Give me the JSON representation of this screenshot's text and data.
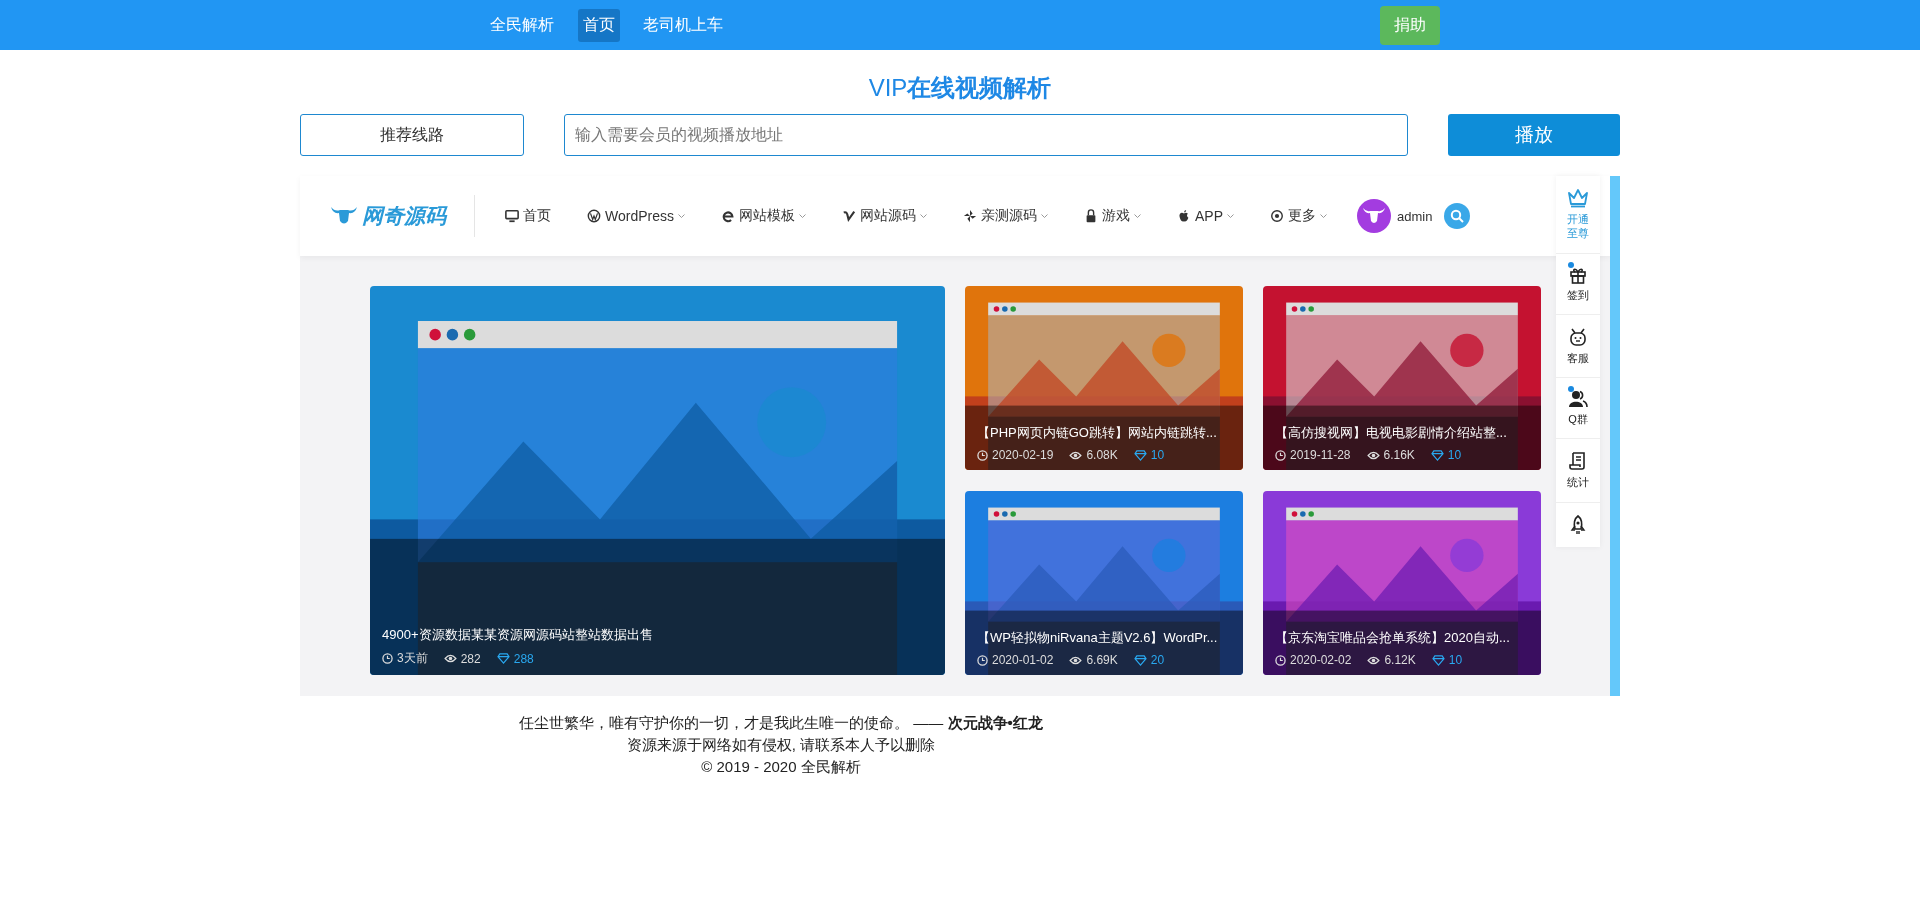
{
  "top_nav": {
    "brand": "全民解析",
    "links": [
      {
        "label": "首页",
        "selected": true
      },
      {
        "label": "老司机上车",
        "selected": false
      }
    ],
    "donate": "捐助"
  },
  "title": "VIP**在线视频解析**",
  "search": {
    "route_button": "推荐线路",
    "placeholder": "输入需要会员的视频播放地址",
    "play_button": "播放"
  },
  "site": {
    "logo": "网奇源码",
    "nav": [
      {
        "label": "首页",
        "dropdown": false
      },
      {
        "label": "WordPress",
        "dropdown": true
      },
      {
        "label": "网站模板",
        "dropdown": true
      },
      {
        "label": "网站源码",
        "dropdown": true
      },
      {
        "label": "亲测源码",
        "dropdown": true
      },
      {
        "label": "游戏",
        "dropdown": true
      },
      {
        "label": "APP",
        "dropdown": true
      },
      {
        "label": "更多",
        "dropdown": true
      }
    ],
    "user": "admin",
    "featured": {
      "title": "4900+资源数据某某资源网源码站整站数据出售",
      "time": "3天前",
      "views": "282",
      "points": "288"
    },
    "cards": [
      {
        "title": "【PHP网页内链GO跳转】网站内链跳转...",
        "time": "2020-02-19",
        "views": "6.08K",
        "points": "10"
      },
      {
        "title": "【高仿搜视网】电视电影剧情介绍站整...",
        "time": "2019-11-28",
        "views": "6.16K",
        "points": "10"
      },
      {
        "title": "【WP轻拟物niRvana主题V2.6】WordPr...",
        "time": "2020-01-02",
        "views": "6.69K",
        "points": "20"
      },
      {
        "title": "【京东淘宝唯品会抢单系统】2020自动...",
        "time": "2020-02-02",
        "views": "6.12K",
        "points": "10"
      }
    ],
    "side_tools": [
      {
        "label": "开通至尊",
        "highlight": true,
        "dot": false
      },
      {
        "label": "签到",
        "highlight": false,
        "dot": true
      },
      {
        "label": "客服",
        "highlight": false,
        "dot": false
      },
      {
        "label": "Q群",
        "highlight": false,
        "dot": true
      },
      {
        "label": "统计",
        "highlight": false,
        "dot": false
      },
      {
        "highlight": false,
        "dot": false
      }
    ]
  },
  "footer": {
    "quote": "任尘世繁华，唯有守护你的一切，才是我此生唯一的使命。 —— **次元战争•红龙**",
    "notice": "资源来源于网络如有侵权, 请联系本人予以删除",
    "copyright": "© 2019 - 2020 全民解析"
  }
}
